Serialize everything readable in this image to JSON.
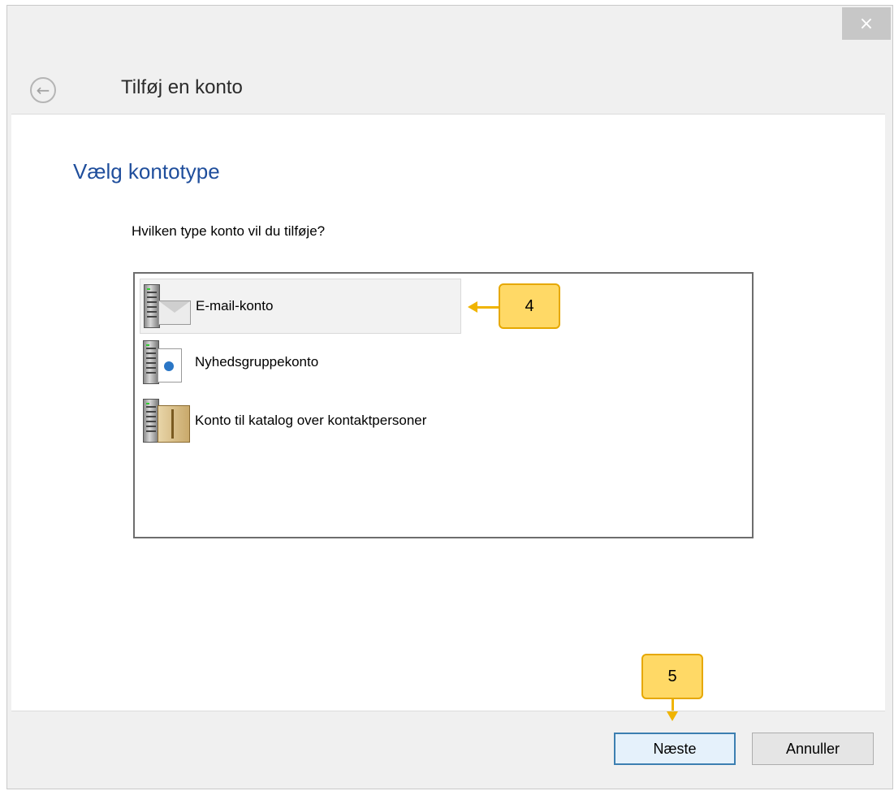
{
  "window": {
    "title": "Tilføj en konto",
    "close_glyph": "×",
    "back_glyph": "←"
  },
  "page": {
    "heading": "Vælg kontotype",
    "question": "Hvilken type konto vil du tilføje?"
  },
  "account_types": [
    {
      "label": "E-mail-konto",
      "icon": "email-server-icon",
      "selected": true
    },
    {
      "label": "Nyhedsgruppekonto",
      "icon": "newsgroup-server-icon",
      "selected": false
    },
    {
      "label": "Konto til katalog over kontaktpersoner",
      "icon": "directory-server-icon",
      "selected": false
    }
  ],
  "callouts": {
    "step4": "4",
    "step5": "5"
  },
  "buttons": {
    "next": "Næste",
    "cancel": "Annuller"
  },
  "colors": {
    "heading": "#1f4e9c",
    "callout_fill": "#ffd966",
    "callout_border": "#e6a800",
    "primary_border": "#3c7fb1"
  }
}
